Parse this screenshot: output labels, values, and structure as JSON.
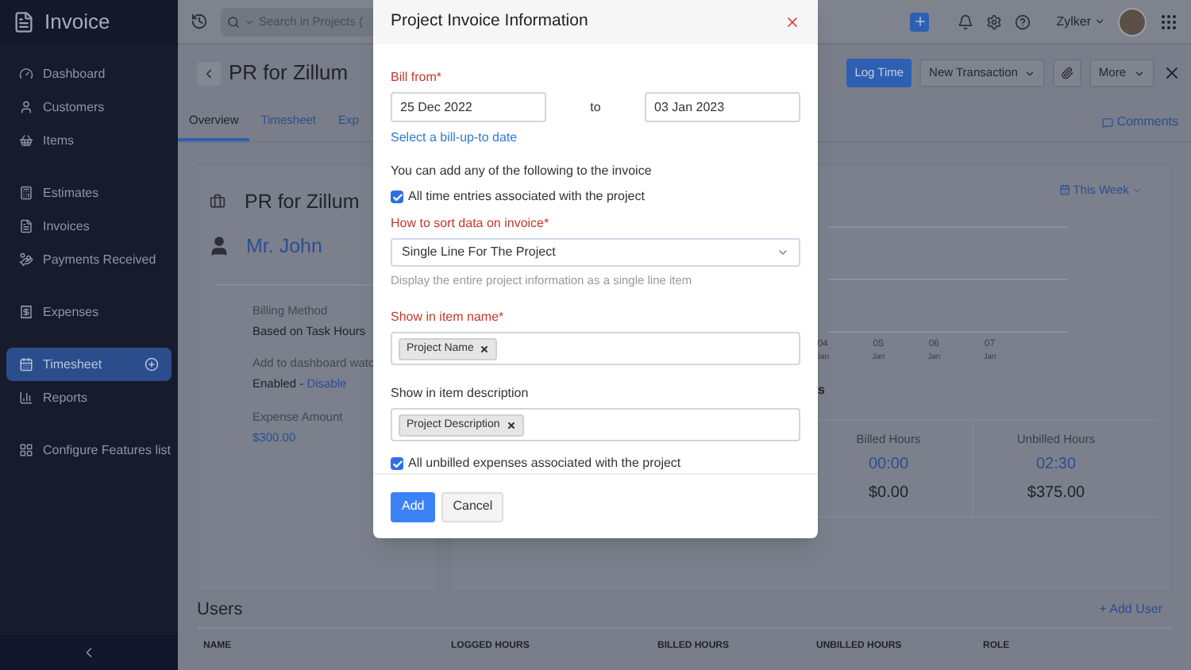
{
  "app": {
    "name": "Invoice"
  },
  "sidebar": {
    "items": [
      {
        "label": "Dashboard",
        "selected": false
      },
      {
        "label": "Customers",
        "selected": false
      },
      {
        "label": "Items",
        "selected": false
      },
      {
        "label": "Estimates",
        "selected": false
      },
      {
        "label": "Invoices",
        "selected": false
      },
      {
        "label": "Payments Received",
        "selected": false
      },
      {
        "label": "Expenses",
        "selected": false
      },
      {
        "label": "Timesheet",
        "selected": true
      },
      {
        "label": "Reports",
        "selected": false
      },
      {
        "label": "Configure Features list",
        "selected": false
      }
    ]
  },
  "topbar": {
    "search_placeholder": "Search in Projects (",
    "org": "Zylker"
  },
  "project": {
    "title": "PR for Zillum",
    "buttons": {
      "log_time": "Log Time",
      "new_transaction": "New Transaction",
      "more": "More"
    },
    "tabs": [
      {
        "label": "Overview",
        "selected": true
      },
      {
        "label": "Timesheet",
        "selected": false
      },
      {
        "label": "Exp",
        "selected": false
      }
    ],
    "comments": "Comments"
  },
  "summary": {
    "name": "PR for Zillum",
    "customer": "Mr. John",
    "fields": [
      {
        "label": "Billing Method",
        "value": "Based on Task Hours"
      },
      {
        "label": "Add to dashboard watc",
        "value": "Enabled - ",
        "link": "Disable"
      },
      {
        "label": "Expense Amount",
        "value": "$300.00",
        "kind": "link"
      }
    ]
  },
  "activity": {
    "period": "This Week",
    "x_labels": [
      {
        "day": "04",
        "month": "Jan"
      },
      {
        "day": "05",
        "month": "Jan"
      },
      {
        "day": "06",
        "month": "Jan"
      },
      {
        "day": "07",
        "month": "Jan"
      }
    ],
    "heading_tail": "s",
    "stats": [
      {
        "label": "Billed Hours",
        "hours": "00:00",
        "amount": "$0.00"
      },
      {
        "label": "Unbilled Hours",
        "hours": "02:30",
        "amount": "$375.00"
      }
    ]
  },
  "users": {
    "title": "Users",
    "add": "+ Add User",
    "columns": [
      "NAME",
      "LOGGED HOURS",
      "BILLED HOURS",
      "UNBILLED HOURS",
      "ROLE"
    ]
  },
  "dialog": {
    "title": "Project Invoice Information",
    "bill_from_label": "Bill from*",
    "from": "25 Dec 2022",
    "to_label": "to",
    "to": "03 Jan 2023",
    "bill_up_to_link": "Select a bill-up-to date",
    "intro": "You can add any of the following to the invoice",
    "time_entries": {
      "label": "All time entries associated with the project",
      "checked": true
    },
    "sort_label": "How to sort data on invoice*",
    "sort_value": "Single Line For The Project",
    "sort_hint": "Display the entire project information as a single line item",
    "item_name_label": "Show in item name*",
    "item_name_tags": [
      "Project Name"
    ],
    "item_desc_label": "Show in item description",
    "item_desc_tags": [
      "Project Description"
    ],
    "expenses": {
      "label": "All unbilled expenses associated with the project",
      "checked": true
    },
    "buttons": {
      "add": "Add",
      "cancel": "Cancel"
    }
  }
}
